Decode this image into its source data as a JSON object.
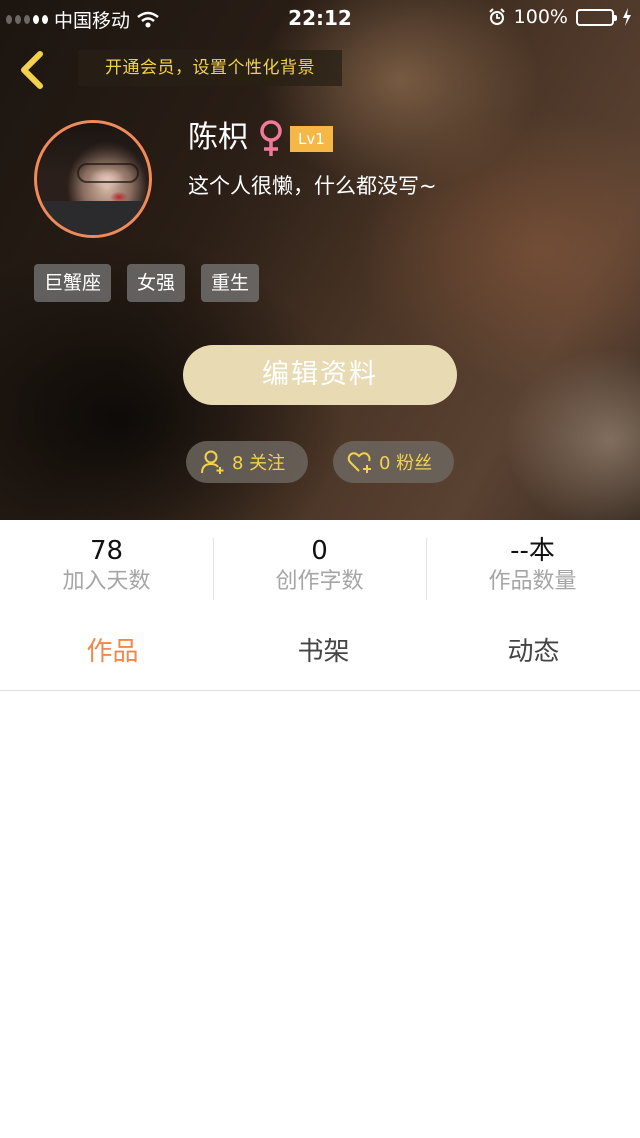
{
  "status_bar": {
    "carrier": "中国移动",
    "time": "22:12",
    "battery": "100%"
  },
  "header": {
    "vip_banner": "开通会员，设置个性化背景",
    "username": "陈枳",
    "gender_symbol": "♀",
    "level": "Lv1",
    "bio": "这个人很懒，什么都没写~",
    "tags": [
      "巨蟹座",
      "女强",
      "重生"
    ],
    "edit_button": "编辑资料",
    "follow": "8 关注",
    "fans": "0 粉丝"
  },
  "stats": [
    {
      "value": "78",
      "label": "加入天数"
    },
    {
      "value": "0",
      "label": "创作字数"
    },
    {
      "value": "--本",
      "label": "作品数量"
    }
  ],
  "tabs": [
    {
      "label": "作品",
      "active": true
    },
    {
      "label": "书架",
      "active": false
    },
    {
      "label": "动态",
      "active": false
    }
  ],
  "colors": {
    "accent": "#f0884a",
    "gold": "#f2d24c",
    "edit_button": "#e8dbb4",
    "level_badge": "#f5b847",
    "gender": "#f07a9a"
  }
}
